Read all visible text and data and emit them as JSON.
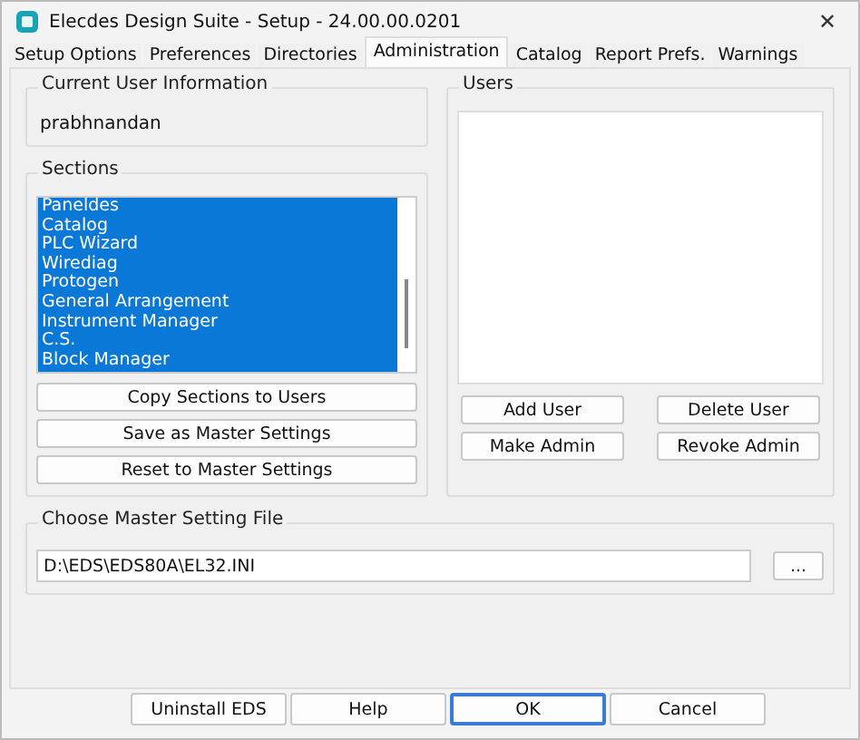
{
  "window": {
    "title": "Elecdes Design Suite - Setup - 24.00.00.0201",
    "close": "✕"
  },
  "tabs": [
    {
      "label": "Setup Options",
      "selected": false
    },
    {
      "label": "Preferences",
      "selected": false
    },
    {
      "label": "Directories",
      "selected": false
    },
    {
      "label": "Administration",
      "selected": true
    },
    {
      "label": "Catalog",
      "selected": false
    },
    {
      "label": "Report Prefs.",
      "selected": false
    },
    {
      "label": "Warnings",
      "selected": false
    }
  ],
  "current_user": {
    "title": "Current User Information",
    "name": "prabhnandan"
  },
  "sections": {
    "title": "Sections",
    "items": [
      {
        "label": "Paneldes",
        "selected": true
      },
      {
        "label": "Catalog",
        "selected": true
      },
      {
        "label": "PLC Wizard",
        "selected": true
      },
      {
        "label": "Wirediag",
        "selected": true
      },
      {
        "label": "Protogen",
        "selected": true
      },
      {
        "label": "General Arrangement",
        "selected": true
      },
      {
        "label": "Instrument Manager",
        "selected": true
      },
      {
        "label": "C.S.",
        "selected": true
      },
      {
        "label": "Block Manager",
        "selected": true
      }
    ],
    "buttons": [
      "Copy Sections to Users",
      "Save as Master Settings",
      "Reset to Master Settings"
    ]
  },
  "users": {
    "title": "Users",
    "buttons": [
      "Add User",
      "Delete User",
      "Make Admin",
      "Revoke Admin"
    ]
  },
  "master_file": {
    "title": "Choose Master Setting File",
    "value": "D:\\EDS\\EDS80A\\EL32.INI",
    "browse": "..."
  },
  "footer_buttons": [
    {
      "label": "Uninstall EDS",
      "default": false
    },
    {
      "label": "Help",
      "default": false
    },
    {
      "label": "OK",
      "default": true
    },
    {
      "label": "Cancel",
      "default": false
    }
  ]
}
